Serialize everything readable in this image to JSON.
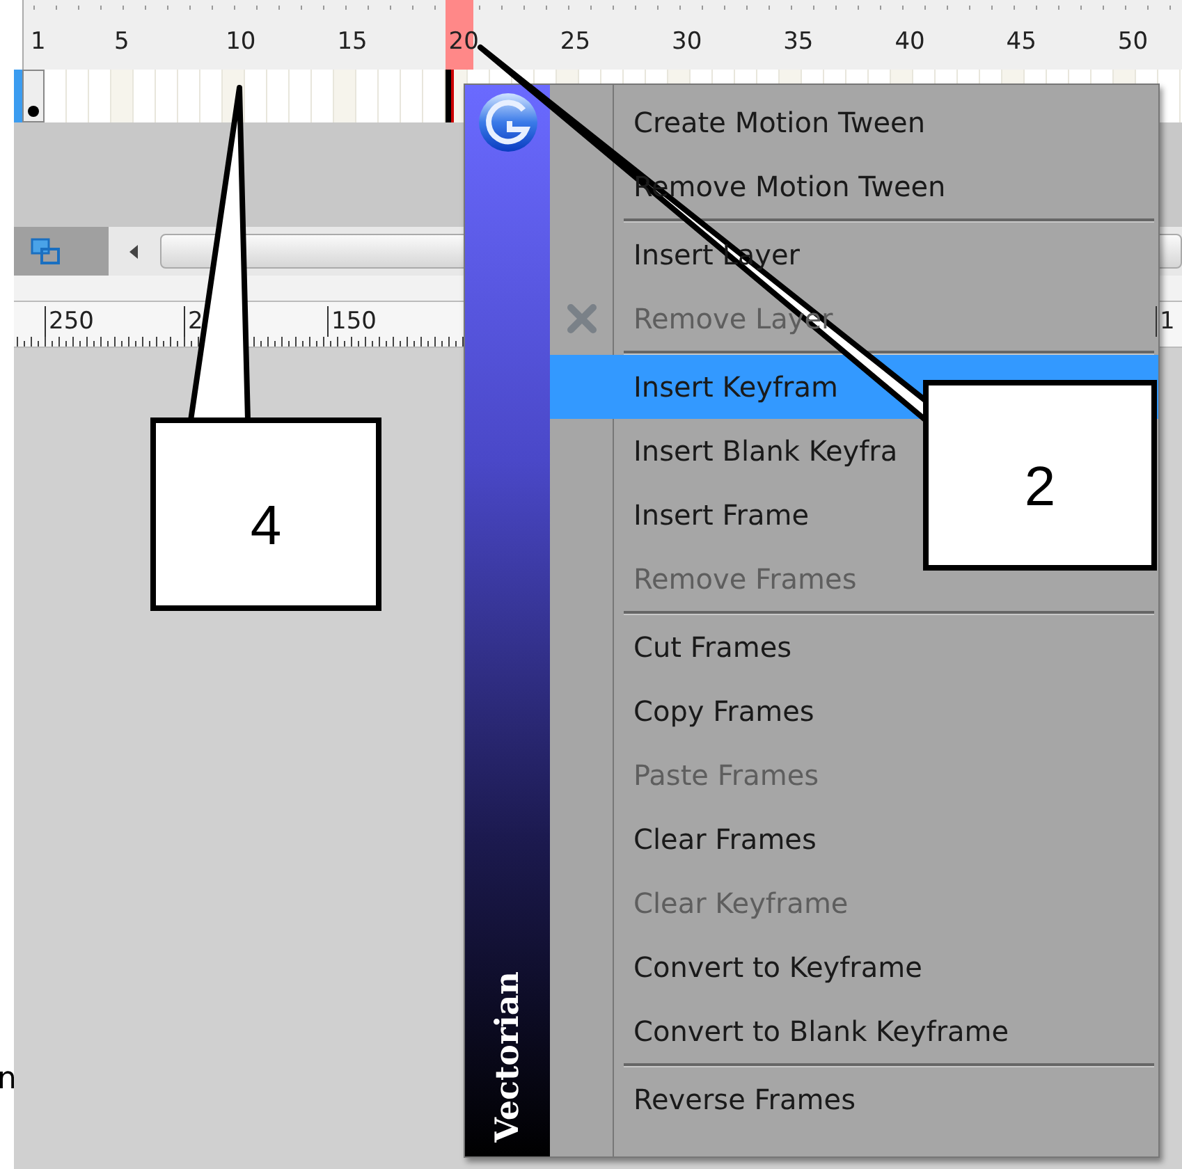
{
  "timeline": {
    "frame_numbers": [
      {
        "label": "1",
        "selected": false
      },
      {
        "label": "5",
        "selected": false
      },
      {
        "label": "10",
        "selected": false
      },
      {
        "label": "15",
        "selected": false
      },
      {
        "label": "20",
        "selected": true
      },
      {
        "label": "25",
        "selected": false
      },
      {
        "label": "30",
        "selected": false
      },
      {
        "label": "35",
        "selected": false
      },
      {
        "label": "40",
        "selected": false
      },
      {
        "label": "45",
        "selected": false
      },
      {
        "label": "50",
        "selected": false
      }
    ]
  },
  "stage_ruler": {
    "labels": [
      "250",
      "2",
      "150",
      "1"
    ]
  },
  "edge_text": "n",
  "context_menu": {
    "brand": "Vectorian",
    "items": [
      {
        "kind": "item",
        "label": "Create Motion Tween",
        "disabled": false,
        "selected": false
      },
      {
        "kind": "item",
        "label": "Remove Motion Tween",
        "disabled": false,
        "selected": false
      },
      {
        "kind": "separator"
      },
      {
        "kind": "item",
        "label": "Insert Layer",
        "disabled": false,
        "selected": false
      },
      {
        "kind": "icon_item",
        "label": "Remove Layer",
        "disabled": true,
        "selected": false
      },
      {
        "kind": "separator"
      },
      {
        "kind": "item",
        "label": "Insert Keyfram",
        "disabled": false,
        "selected": true
      },
      {
        "kind": "item",
        "label": "Insert Blank Keyfra",
        "disabled": false,
        "selected": false
      },
      {
        "kind": "item",
        "label": "Insert Frame",
        "disabled": false,
        "selected": false
      },
      {
        "kind": "item",
        "label": "Remove Frames",
        "disabled": true,
        "selected": false
      },
      {
        "kind": "separator"
      },
      {
        "kind": "item",
        "label": "Cut Frames",
        "disabled": false,
        "selected": false
      },
      {
        "kind": "item",
        "label": "Copy Frames",
        "disabled": false,
        "selected": false
      },
      {
        "kind": "item",
        "label": "Paste Frames",
        "disabled": true,
        "selected": false
      },
      {
        "kind": "item",
        "label": "Clear Frames",
        "disabled": false,
        "selected": false
      },
      {
        "kind": "item",
        "label": "Clear Keyframe",
        "disabled": true,
        "selected": false
      },
      {
        "kind": "item",
        "label": "Convert to Keyframe",
        "disabled": false,
        "selected": false
      },
      {
        "kind": "item",
        "label": "Convert to Blank Keyframe",
        "disabled": false,
        "selected": false
      },
      {
        "kind": "separator"
      },
      {
        "kind": "item",
        "label": "Reverse Frames",
        "disabled": false,
        "selected": false
      }
    ]
  },
  "callouts": [
    {
      "label": "4"
    },
    {
      "label": "2"
    }
  ]
}
